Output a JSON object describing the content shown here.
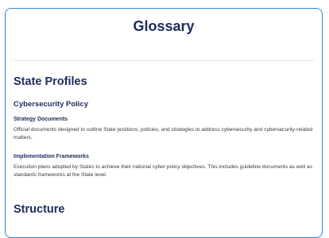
{
  "title": "Glossary",
  "sections": [
    {
      "heading": "State Profiles",
      "subsection": {
        "heading": "Cybersecurity Policy",
        "entries": [
          {
            "term": "Strategy Documents",
            "definition": "Official documents designed to outline State positions, policies, and strategies to address cybersecurity and cybersecurity-related matters."
          },
          {
            "term": "Implementation Frameworks",
            "definition": "Execution plans adopted by States to achieve their national cyber policy objectives. This includes guideline documents as well as standards frameworks at the State level."
          }
        ]
      }
    },
    {
      "heading": "Structure"
    }
  ],
  "colors": {
    "frame_border": "#2f86d6",
    "heading": "#1d2a5c",
    "body_text": "#333a44",
    "divider": "#e3e6ea"
  }
}
